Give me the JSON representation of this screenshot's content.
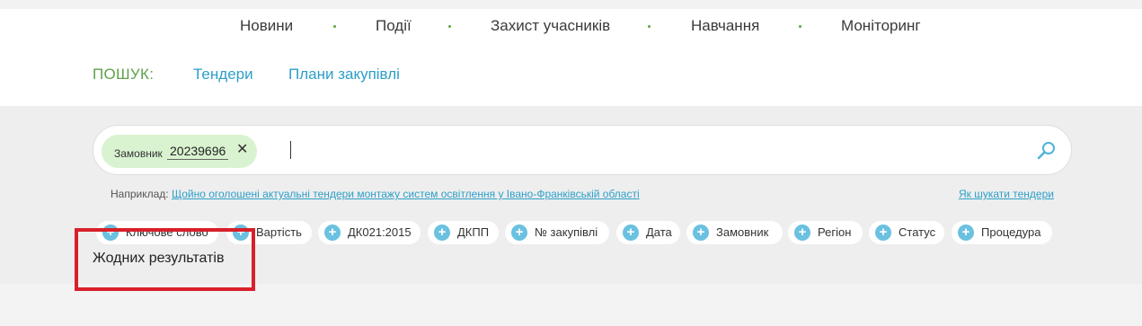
{
  "nav": {
    "items": [
      "Новини",
      "Події",
      "Захист учасників",
      "Навчання",
      "Моніторинг"
    ]
  },
  "search": {
    "label": "ПОШУК:",
    "tabs": [
      "Тендери",
      "Плани закупівлі"
    ],
    "active_tab": "Тендери",
    "chip": {
      "key": "Замовник",
      "value": "20239696"
    },
    "input_value": "",
    "example_prefix": "Наприклад:",
    "example_link": "Щойно оголошені актуальні тендери монтажу систем освітлення у Івано-Франківській області",
    "help_link": "Як шукати тендери"
  },
  "filters": [
    "Ключове слово",
    "Вартість",
    "ДК021:2015",
    "ДКПП",
    "№ закупівлі",
    "Дата",
    "Замовник",
    "Регіон",
    "Статус",
    "Процедура"
  ],
  "results": {
    "message": "Жодних результатів"
  },
  "colors": {
    "accent_green": "#5fa24a",
    "link_blue": "#2d9fc8",
    "chip_bg": "#d9f3d0",
    "plus_blue": "#6ac1e0",
    "highlight_red": "#d8202a"
  },
  "icons": {
    "search": "search-icon",
    "close": "close-icon",
    "plus": "plus-icon"
  }
}
